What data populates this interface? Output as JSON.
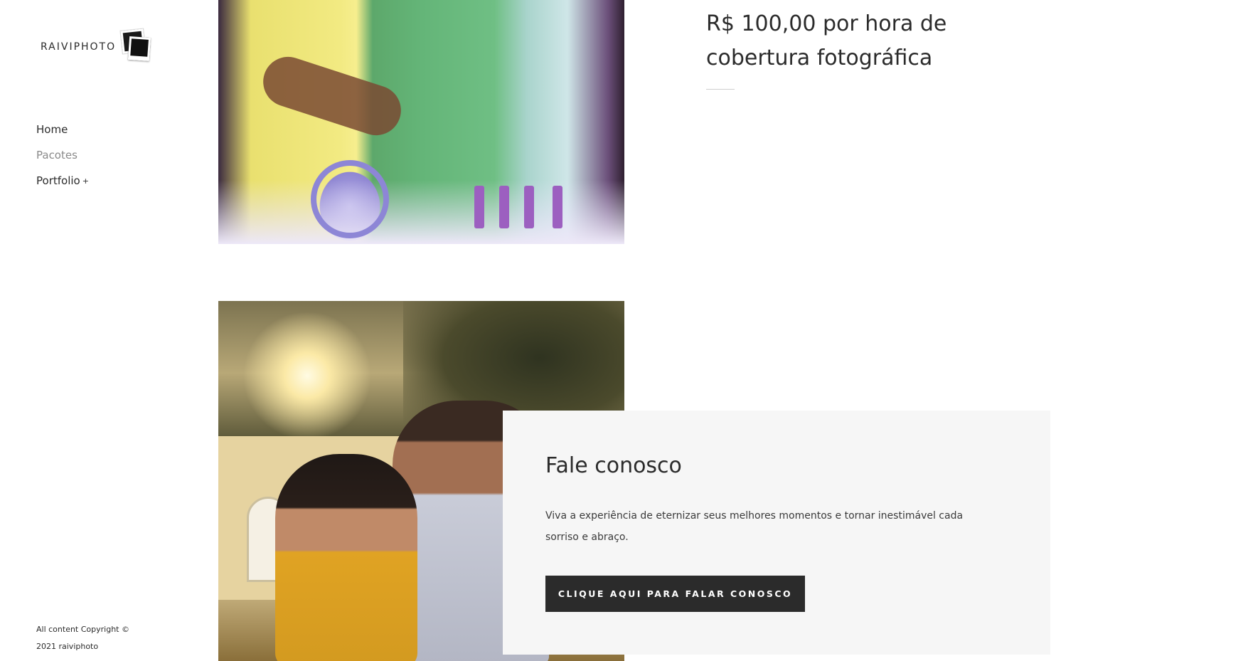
{
  "brand": {
    "logo_text": "RAIVIPHOTO"
  },
  "nav": {
    "items": [
      {
        "label": "Home"
      },
      {
        "label": "Pacotes"
      },
      {
        "label": "Portfolio",
        "suffix": "+"
      }
    ]
  },
  "footer": {
    "copyright_line1": "All content Copyright ©",
    "copyright_line2": "2021 raiviphoto"
  },
  "package": {
    "price_text": "R$ 100,00 por hora de cobertura fotográfica"
  },
  "contact": {
    "title": "Fale conosco",
    "text": "Viva a experiência de eternizar seus melhores momentos e tornar inestimável cada sorriso e abraço.",
    "button_label": "CLIQUE AQUI PARA FALAR CONOSCO"
  },
  "colors": {
    "background": "#ffffff",
    "card": "#f6f6f6",
    "button": "#2b2b2b",
    "text": "#2b2b2b",
    "muted_nav": "#8a8a8a"
  }
}
